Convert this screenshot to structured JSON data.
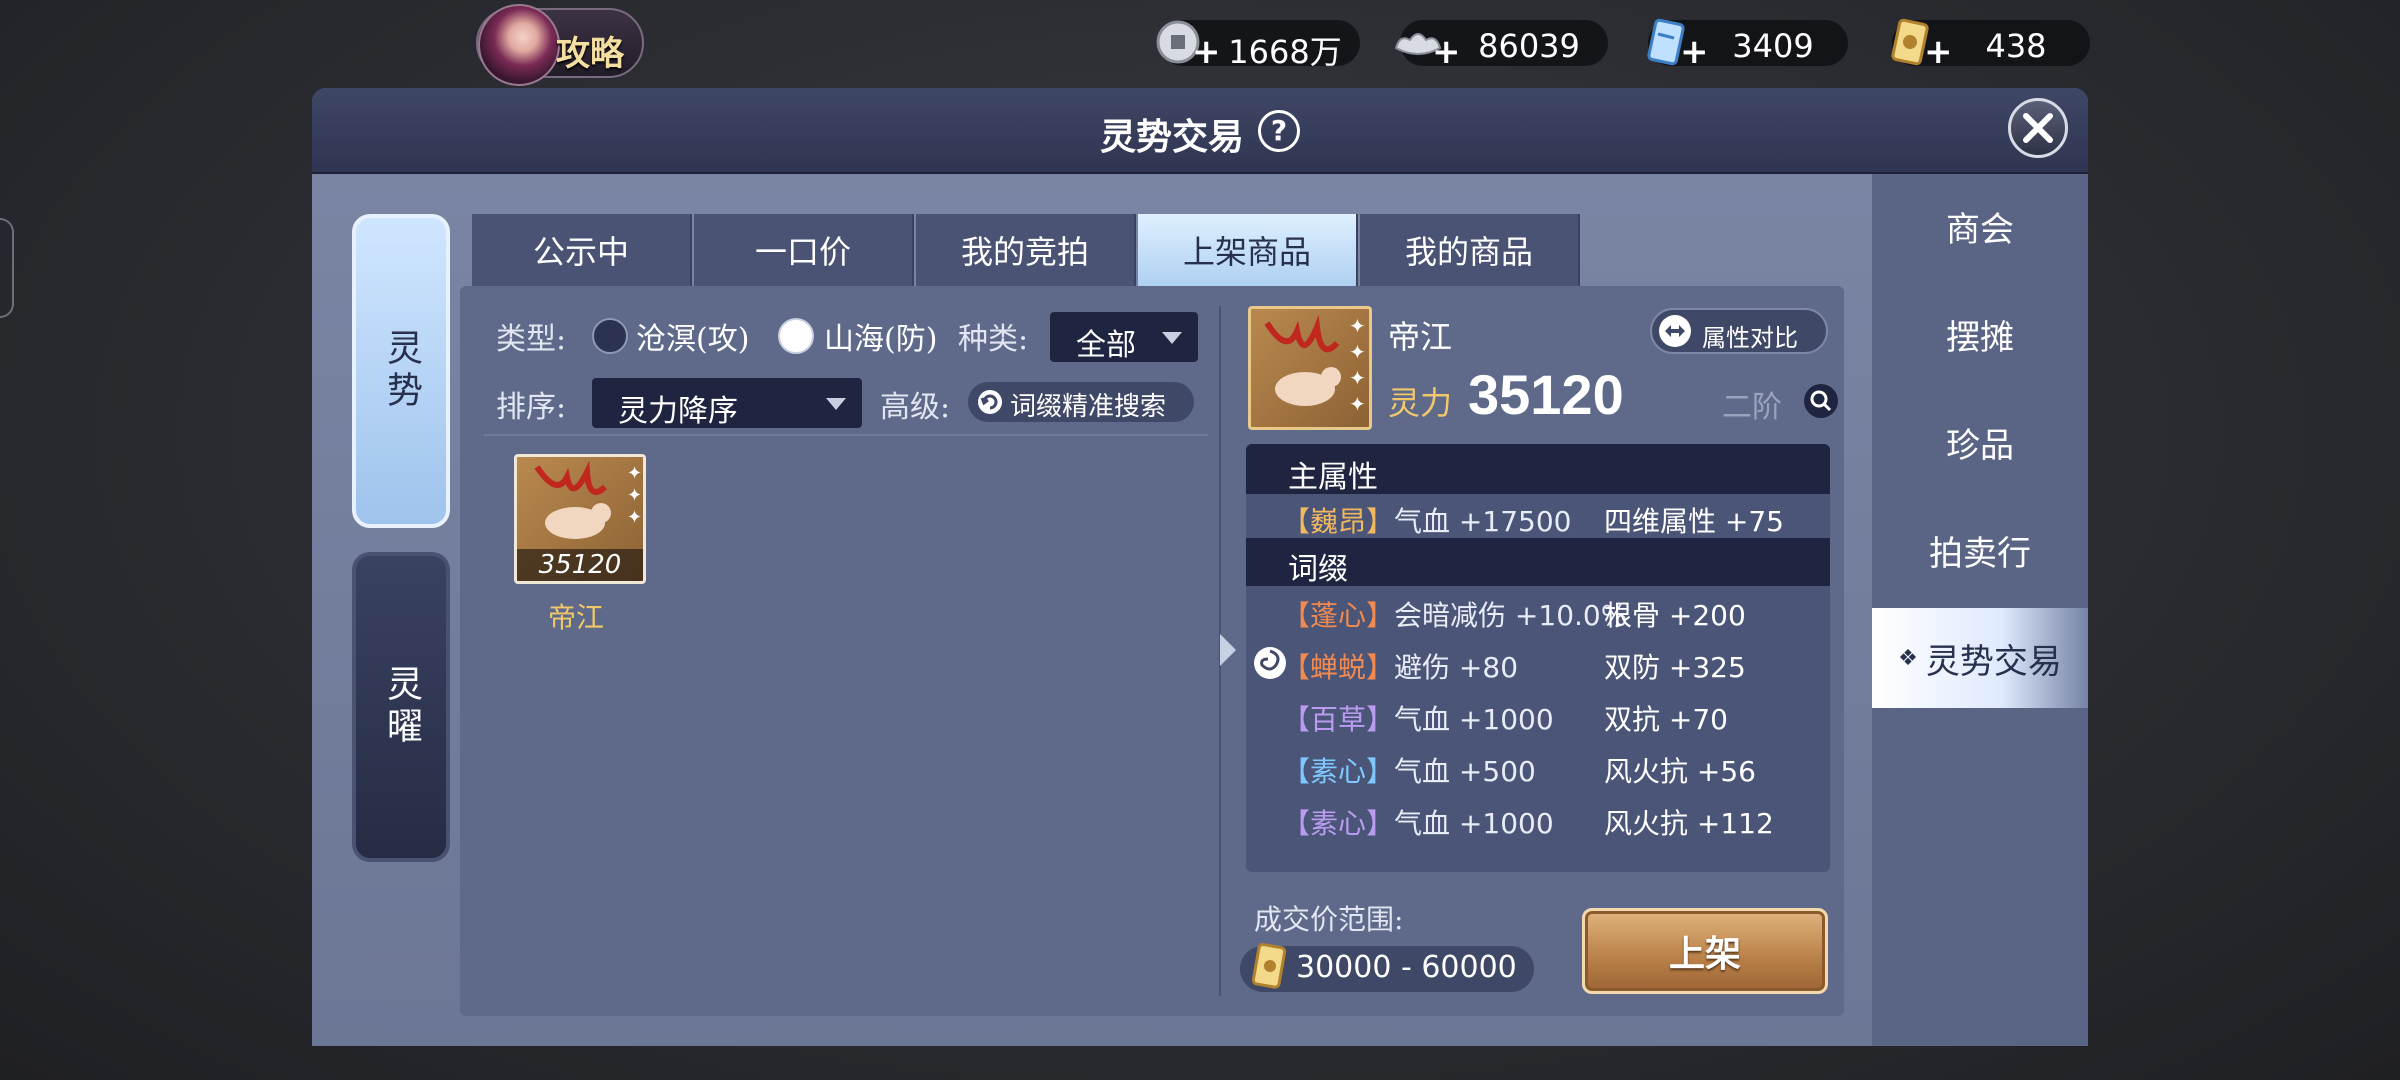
{
  "top_bar": {
    "guide_label": "攻略",
    "currencies": [
      {
        "name": "copper-coin",
        "value": "1668万"
      },
      {
        "name": "silver-ingot",
        "value": "86039"
      },
      {
        "name": "blue-token",
        "value": "3409"
      },
      {
        "name": "gold-token",
        "value": "438"
      }
    ]
  },
  "panel": {
    "title": "灵势交易",
    "help": "?"
  },
  "left_tabs": [
    "灵势",
    "灵曜"
  ],
  "top_tabs": [
    "公示中",
    "一口价",
    "我的竞拍",
    "上架商品",
    "我的商品"
  ],
  "active_top_tab": "上架商品",
  "filters": {
    "type_label": "类型:",
    "option_attack": "沧溟(攻)",
    "option_defense": "山海(防)",
    "kind_label": "种类:",
    "kind_value": "全部",
    "sort_label": "排序:",
    "sort_value": "灵力降序",
    "advanced_label": "高级:",
    "search_button": "词缀精准搜索"
  },
  "items": [
    {
      "name": "帝江",
      "power": "35120"
    }
  ],
  "detail": {
    "name": "帝江",
    "compare_button": "属性对比",
    "power_label": "灵力",
    "power": "35120",
    "tier": "二阶",
    "main_attr_header": "主属性",
    "main_attrs": [
      {
        "tag": "【巍昂】",
        "attr": "气血 +17500",
        "attr2": "四维属性 +75"
      }
    ],
    "affix_header": "词缀",
    "affixes": [
      {
        "tag": "【蓬心】",
        "attr": "会暗减伤 +10.0%",
        "attr2": "根骨 +200"
      },
      {
        "tag": "【蝉蜕】",
        "attr": "避伤 +80",
        "attr2": "双防 +325"
      },
      {
        "tag": "【百草】",
        "attr": "气血 +1000",
        "attr2": "双抗 +70"
      },
      {
        "tag": "【素心】",
        "attr": "气血 +500",
        "attr2": "风火抗 +56"
      },
      {
        "tag": "【素心】",
        "attr": "气血 +1000",
        "attr2": "风火抗 +112"
      }
    ],
    "price_label": "成交价范围:",
    "price_range": "30000 - 60000",
    "list_button": "上架"
  },
  "right_nav": [
    "商会",
    "摆摊",
    "珍品",
    "拍卖行",
    "灵势交易"
  ],
  "right_nav_active": "灵势交易"
}
